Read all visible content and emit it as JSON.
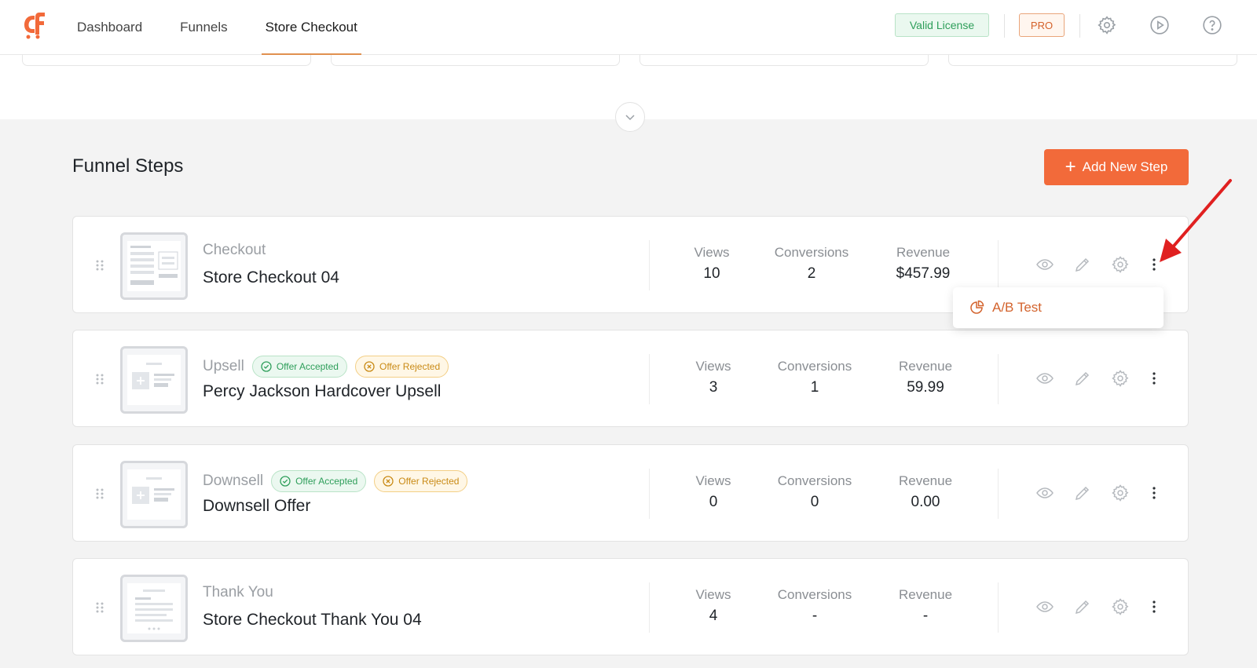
{
  "nav": {
    "items": [
      {
        "label": "Dashboard"
      },
      {
        "label": "Funnels"
      },
      {
        "label": "Store Checkout"
      }
    ],
    "active_index": 2
  },
  "header": {
    "license_badge": "Valid License",
    "pro_badge": "PRO",
    "icons": [
      "gear-icon",
      "play-icon",
      "help-icon"
    ]
  },
  "section": {
    "title": "Funnel Steps",
    "add_button": "Add New Step"
  },
  "steps": [
    {
      "type": "Checkout",
      "name": "Store Checkout 04",
      "views_label": "Views",
      "views": "10",
      "conversions_label": "Conversions",
      "conversions": "2",
      "revenue_label": "Revenue",
      "revenue": "$457.99"
    },
    {
      "type": "Upsell",
      "tag_accepted": "Offer Accepted",
      "tag_rejected": "Offer Rejected",
      "name": "Percy Jackson Hardcover Upsell",
      "views_label": "Views",
      "views": "3",
      "conversions_label": "Conversions",
      "conversions": "1",
      "revenue_label": "Revenue",
      "revenue": "59.99"
    },
    {
      "type": "Downsell",
      "tag_accepted": "Offer Accepted",
      "tag_rejected": "Offer Rejected",
      "name": "Downsell Offer",
      "views_label": "Views",
      "views": "0",
      "conversions_label": "Conversions",
      "conversions": "0",
      "revenue_label": "Revenue",
      "revenue": "0.00"
    },
    {
      "type": "Thank You",
      "name": "Store Checkout Thank You 04",
      "views_label": "Views",
      "views": "4",
      "conversions_label": "Conversions",
      "conversions": "-",
      "revenue_label": "Revenue",
      "revenue": "-"
    }
  ],
  "dropdown": {
    "item": "A/B Test"
  },
  "colors": {
    "accent": "#f26a3a",
    "success": "#2e9e5a",
    "warning": "#c98a15",
    "annotation_arrow": "#e02020"
  }
}
